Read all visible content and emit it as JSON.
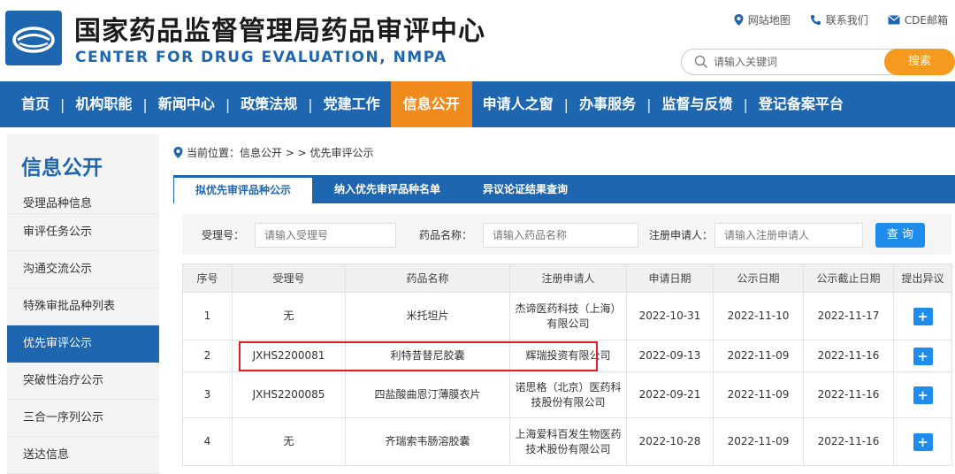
{
  "header": {
    "title_cn": "国家药品监督管理局药品审评中心",
    "title_en": "CENTER FOR DRUG EVALUATION, NMPA",
    "links": [
      "网站地图",
      "联系我们",
      "CDE邮箱"
    ],
    "search_placeholder": "请输入关键词",
    "search_button": "搜索"
  },
  "nav": {
    "items": [
      "首页",
      "机构职能",
      "新闻中心",
      "政策法规",
      "党建工作",
      "信息公开",
      "申请人之窗",
      "办事服务",
      "监督与反馈",
      "登记备案平台"
    ],
    "active": "信息公开"
  },
  "sidebar": {
    "title": "信息公开",
    "items": [
      "受理品种信息",
      "审评任务公示",
      "沟通交流公示",
      "特殊审批品种列表",
      "优先审评公示",
      "突破性治疗公示",
      "三合一序列公示",
      "送达信息"
    ],
    "active": "优先审评公示"
  },
  "breadcrumb": {
    "text": "当前位置：信息公开 > > 优先审评公示"
  },
  "tabs": [
    "拟优先审评品种公示",
    "纳入优先审评品种名单",
    "异议论证结果查询"
  ],
  "filter": {
    "labels": [
      "受理号：",
      "药品名称：",
      "注册申请人："
    ],
    "placeholders": [
      "请输入受理号",
      "请输入药品名称",
      "请输入注册申请人"
    ],
    "query_button": "查 询"
  },
  "table": {
    "headers": [
      "序号",
      "受理号",
      "药品名称",
      "注册申请人",
      "申请日期",
      "公示日期",
      "公示截止日期",
      "提出异议"
    ],
    "rows": [
      [
        "1",
        "无",
        "米托坦片",
        "杰谛医药科技（上海）有限公司",
        "2022-10-31",
        "2022-11-10",
        "2022-11-17",
        "+"
      ],
      [
        "2",
        "JXHS2200081",
        "利特昔替尼胶囊",
        "辉瑞投资有限公司",
        "2022-09-13",
        "2022-11-09",
        "2022-11-16",
        "+"
      ],
      [
        "3",
        "JXHS2200085",
        "四盐酸曲恩汀薄膜衣片",
        "诺思格（北京）医药科技股份有限公司",
        "2022-09-21",
        "2022-11-09",
        "2022-11-16",
        "+"
      ],
      [
        "4",
        "无",
        "齐瑞索韦肠溶胶囊",
        "上海爱科百发生物医药技术股份有限公司",
        "2022-10-28",
        "2022-11-09",
        "2022-11-16",
        "+"
      ]
    ]
  },
  "colors": {
    "brand_blue": "#1f66b1",
    "nav_active_orange": "#f08a1d",
    "search_orange": "#f39a1f",
    "button_blue": "#1f8ceb",
    "highlight_red": "#e02020"
  }
}
